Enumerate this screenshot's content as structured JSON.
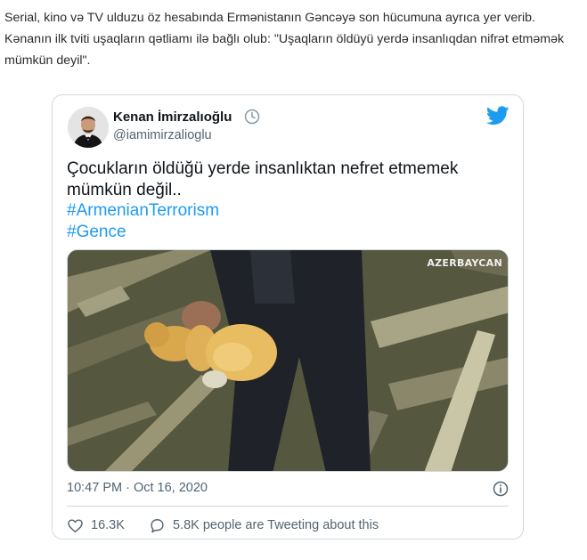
{
  "article": {
    "paragraph": "Serial, kino və TV ulduzu öz hesabında Ermənistanın Gəncəyə son hücumuna ayrıca yer verib. Kənanın ilk tviti uşaqların qətliamı ilə bağlı olub: \"Uşaqların öldüyü yerdə insanlıqdan nifrət etməmək mümkün deyil\"."
  },
  "tweet": {
    "display_name": "Kenan İmirzalıoğlu",
    "handle": "@iamimirzalioglu",
    "text": "Çocukların öldüğü yerde insanlıktan nefret etmemek mümkün değil..",
    "hashtags": [
      "#ArmenianTerrorism",
      "#Gence"
    ],
    "media_watermark": "AZERBAYCAN",
    "timestamp": "10:47 PM · Oct 16, 2020",
    "likes": "16.3K",
    "reply_text": "5.8K people are Tweeting about this"
  },
  "icons": {
    "verified": "clock-badge-icon",
    "brand": "twitter-bird-icon",
    "info": "info-icon",
    "like": "heart-icon",
    "reply": "speech-bubble-icon"
  },
  "colors": {
    "twitter_blue": "#1d9bf0",
    "secondary_text": "#536471",
    "border": "#cfd9de"
  }
}
